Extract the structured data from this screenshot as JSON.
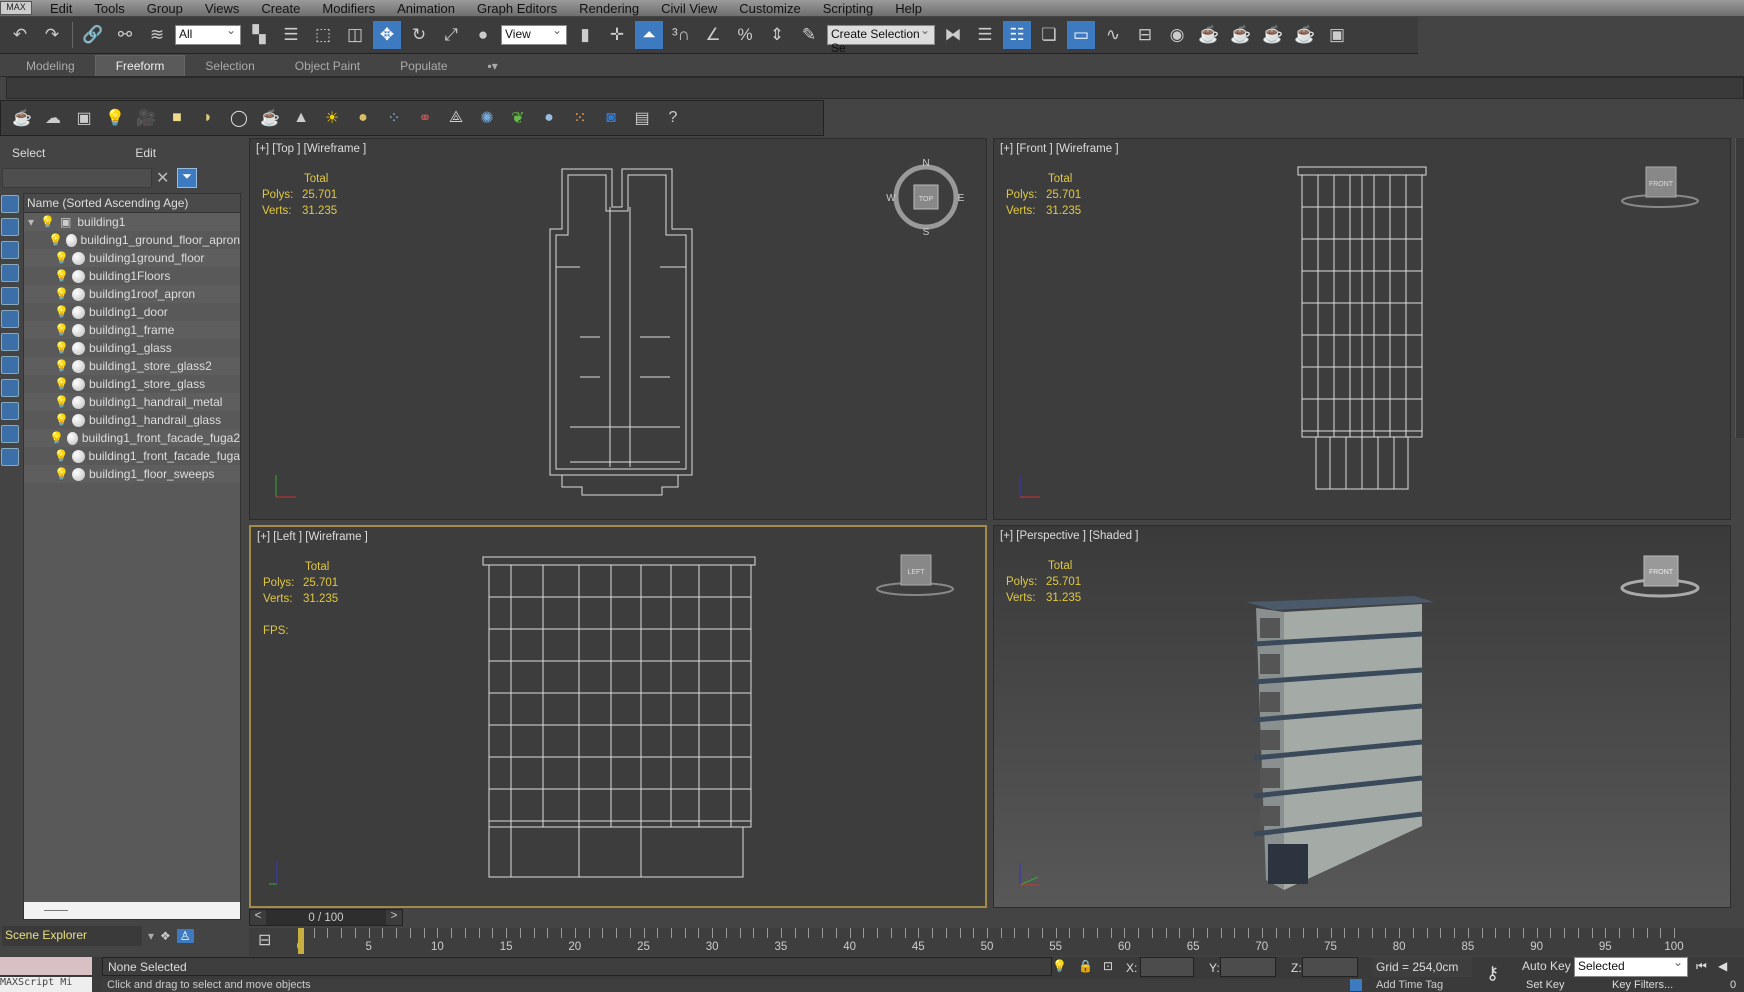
{
  "menu": {
    "logo": "MAX",
    "items": [
      "Edit",
      "Tools",
      "Group",
      "Views",
      "Create",
      "Modifiers",
      "Animation",
      "Graph Editors",
      "Rendering",
      "Civil View",
      "Customize",
      "Scripting",
      "Help"
    ]
  },
  "toolbar": {
    "selection_filter": "All",
    "reference_coord": "View",
    "named_selection_placeholder": "Create Selection Se"
  },
  "ribbon": {
    "tabs": [
      "Modeling",
      "Freeform",
      "Selection",
      "Object Paint",
      "Populate"
    ],
    "active": "Freeform"
  },
  "explorer": {
    "menu": [
      "Select",
      "Edit"
    ],
    "column_header": "Name (Sorted Ascending Age)",
    "root": "building1",
    "items": [
      "building1_ground_floor_apron",
      "building1ground_floor",
      "building1Floors",
      "building1roof_apron",
      "building1_door",
      "building1_frame",
      "building1_glass",
      "building1_store_glass2",
      "building1_store_glass",
      "building1_handrail_metal",
      "building1_handrail_glass",
      "building1_front_facade_fuga2",
      "building1_front_facade_fuga",
      "building1_floor_sweeps"
    ],
    "footer_label": "Scene Explorer"
  },
  "viewports": [
    {
      "label": "[+] [Top ] [Wireframe ]",
      "cube": "TOP"
    },
    {
      "label": "[+] [Front ] [Wireframe ]",
      "cube": "FRONT"
    },
    {
      "label": "[+] [Left ] [Wireframe ]",
      "cube": "LEFT",
      "fps": "FPS:"
    },
    {
      "label": "[+] [Perspective ] [Shaded ]",
      "cube": "FRONT"
    }
  ],
  "stats": {
    "total": "Total",
    "polys_label": "Polys:",
    "polys": "25.701",
    "verts_label": "Verts:",
    "verts": "31.235"
  },
  "compass": {
    "n": "N",
    "s": "S",
    "e": "E",
    "w": "W"
  },
  "timeline": {
    "frame": "0 / 100",
    "prev": "<",
    "next": ">",
    "ticks": [
      0,
      5,
      10,
      15,
      20,
      25,
      30,
      35,
      40,
      45,
      50,
      55,
      60,
      65,
      70,
      75,
      80,
      85,
      90,
      95,
      100
    ]
  },
  "status": {
    "maxscript": "MAXScript Mi",
    "selection": "None Selected",
    "prompt": "Click and drag to select and move objects",
    "x_label": "X:",
    "y_label": "Y:",
    "z_label": "Z:",
    "grid": "Grid = 254,0cm",
    "add_time_tag": "Add Time Tag",
    "auto_key": "Auto Key",
    "set_key": "Set Key",
    "key_mode": "Selected",
    "key_filters": "Key Filters...",
    "frame_field": "0"
  }
}
